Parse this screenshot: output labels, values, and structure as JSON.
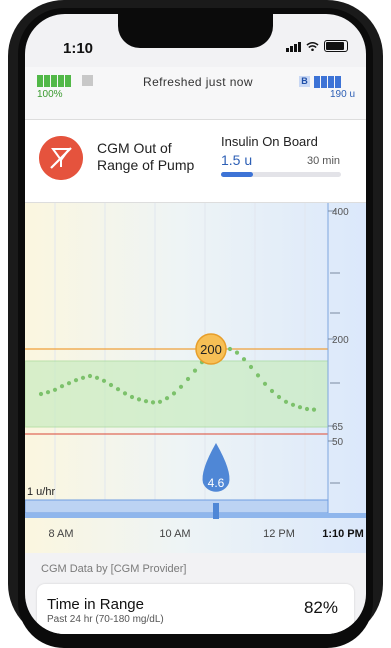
{
  "status_bar": {
    "time": "1:10"
  },
  "device_bar": {
    "pump_battery_pct": "100%",
    "refreshed_text": "Refreshed just now",
    "reservoir_badge": "B",
    "insulin_units": "190 u"
  },
  "info": {
    "cgm_status": "CGM Out of Range of Pump",
    "iob_title": "Insulin On Board",
    "iob_value": "1.5 u",
    "iob_time": "30 min",
    "iob_progress": 0.27
  },
  "colors": {
    "high_line": "#f0a13a",
    "low_line": "#e06a5a",
    "target_band": "#c9ecc0",
    "cgm_points": "#7cc16b",
    "insulin_blue": "#4f87d6",
    "alert_red": "#e5533d"
  },
  "chart_data": {
    "type": "scatter",
    "y_ticks": [
      "400",
      "200",
      "65",
      "50"
    ],
    "x_ticks": [
      "8 AM",
      "10 AM",
      "12 PM",
      "1:10 PM"
    ],
    "current_bg_badge": "200",
    "bolus_badge": "4.6",
    "basal_label": "1 u/hr",
    "high_threshold": 200,
    "low_threshold": 65,
    "ylim": [
      0,
      400
    ],
    "points": [
      [
        7.6,
        125
      ],
      [
        7.7,
        128
      ],
      [
        7.8,
        132
      ],
      [
        7.9,
        138
      ],
      [
        8.0,
        143
      ],
      [
        8.1,
        148
      ],
      [
        8.2,
        152
      ],
      [
        8.3,
        155
      ],
      [
        8.4,
        152
      ],
      [
        8.5,
        147
      ],
      [
        8.6,
        140
      ],
      [
        8.7,
        133
      ],
      [
        8.8,
        126
      ],
      [
        8.9,
        120
      ],
      [
        9.0,
        116
      ],
      [
        9.1,
        113
      ],
      [
        9.2,
        111
      ],
      [
        9.3,
        112
      ],
      [
        9.4,
        118
      ],
      [
        9.5,
        126
      ],
      [
        9.6,
        137
      ],
      [
        9.7,
        150
      ],
      [
        9.8,
        164
      ],
      [
        9.9,
        178
      ],
      [
        10.0,
        190
      ],
      [
        10.1,
        198
      ],
      [
        10.2,
        202
      ],
      [
        10.3,
        200
      ],
      [
        10.4,
        194
      ],
      [
        10.5,
        183
      ],
      [
        10.6,
        170
      ],
      [
        10.7,
        156
      ],
      [
        10.8,
        142
      ],
      [
        10.9,
        130
      ],
      [
        11.0,
        120
      ],
      [
        11.1,
        112
      ],
      [
        11.2,
        107
      ],
      [
        11.3,
        103
      ],
      [
        11.4,
        100
      ],
      [
        11.5,
        99
      ]
    ],
    "bolus_time": 10.1
  },
  "footer": {
    "source": "CGM Data by [CGM Provider]",
    "tir_title": "Time in Range",
    "tir_sub": "Past 24 hr (70-180 mg/dL)",
    "tir_pct": "82%"
  }
}
